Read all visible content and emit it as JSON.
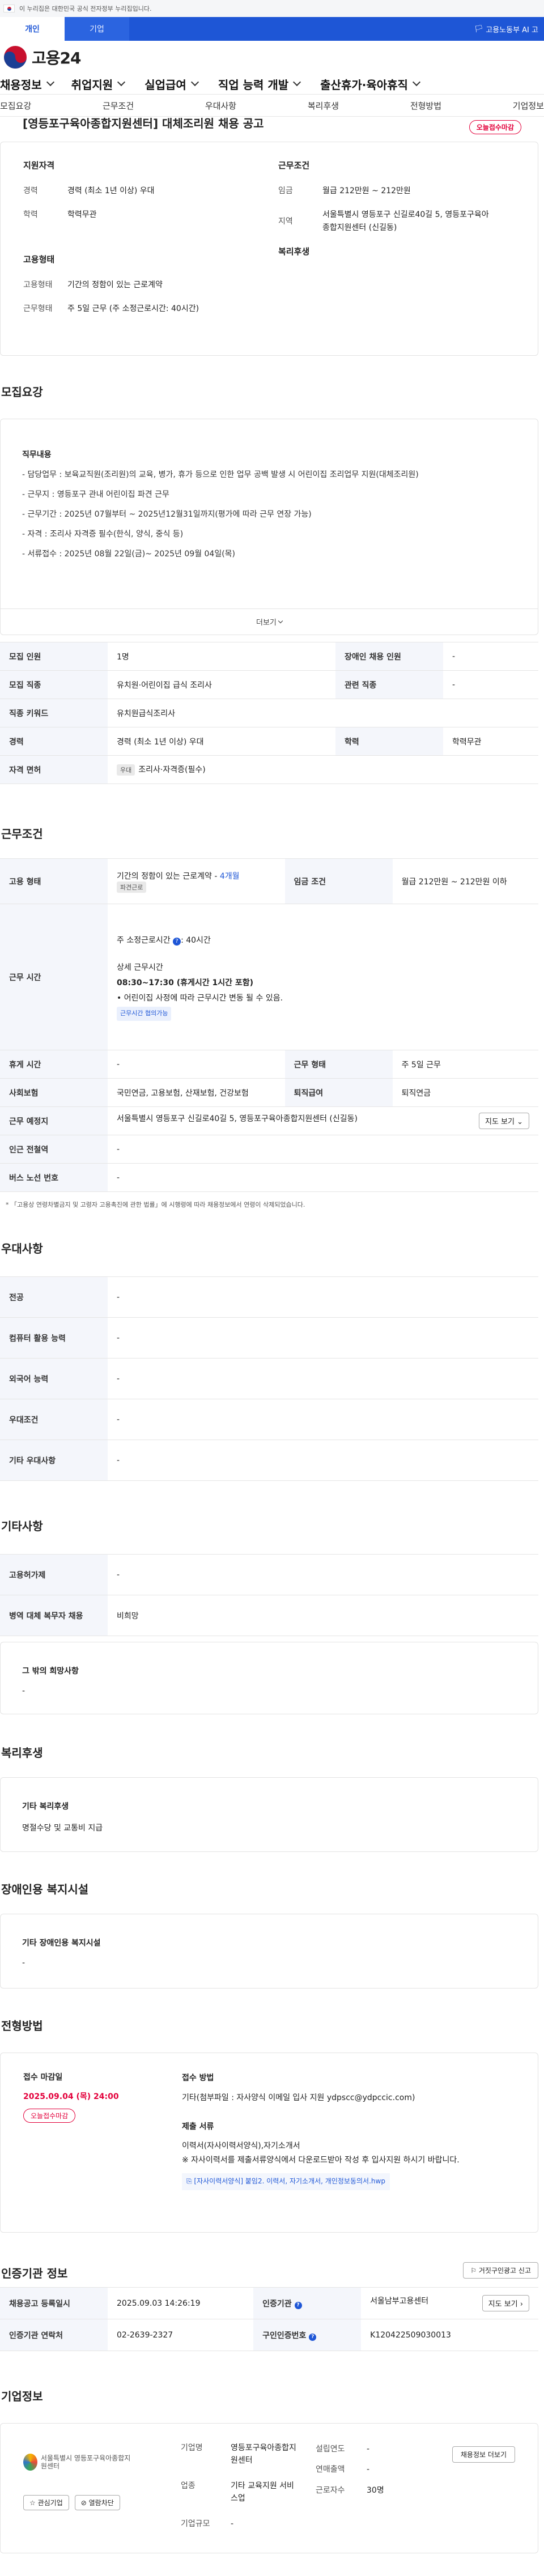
{
  "gov_notice": "이 누리집은 대한민국 공식 전자정부 누리집입니다.",
  "site_tabs": [
    "개인",
    "기업"
  ],
  "ministry": "고용노동부 AI 고",
  "logo": "고용24",
  "gnb": [
    "채용정보",
    "취업지원",
    "실업급여",
    "직업 능력 개발",
    "출산휴가·육아휴직"
  ],
  "subnav": [
    "모집요강",
    "근무조건",
    "우대사항",
    "복리후생",
    "전형방법",
    "기업정보"
  ],
  "posting": {
    "title": "[영등포구육아종합지원센터] 대체조리원 채용 공고",
    "badge": "오늘접수마감"
  },
  "summary": {
    "qual": {
      "title": "지원자격",
      "career_k": "경력",
      "career_v": "경력 (최소 1년 이상) 우대",
      "edu_k": "학력",
      "edu_v": "학력무관"
    },
    "cond": {
      "title": "근무조건",
      "pay_k": "임금",
      "pay_v": "월급 212만원 ~ 212만원",
      "area_k": "지역",
      "area_v": "서울특별시 영등포구 신길로40길 5, 영등포구육아종합지원센터 (신길동)"
    },
    "form": {
      "title": "고용형태",
      "type_k": "고용형태",
      "type_v": "기간의 정함이 있는 근로계약",
      "hours_k": "근무형태",
      "hours_v": "주 5일 근무 (주 소정근로시간: 40시간)"
    },
    "welfare": {
      "title": "복리후생"
    }
  },
  "recruit": {
    "title": "모집요강",
    "job_head": "직무내용",
    "job_lines": [
      "- 담당업무 : 보육교직원(조리원)의 교육, 병가, 휴가 등으로 인한 업무 공백 발생 시 어린이집 조리업무 지원(대체조리원)",
      "- 근무지 : 영등포구 관내 어린이집 파견 근무",
      "- 근무기간 : 2025년 07월부터 ~ 2025년12월31일까지(평가에 따라 근무 연장 가능)",
      "- 자격 : 조리사 자격증 필수(한식, 양식, 중식 등)",
      "- 서류접수 : 2025년 08월 22일(금)~ 2025년 09월 04일(목)"
    ],
    "more": "더보기",
    "rows": {
      "count_k": "모집 인원",
      "count_v": "1명",
      "dis_k": "장애인 채용 인원",
      "dis_v": "-",
      "job_k": "모집 직종",
      "job_v": "유치원·어린이집 급식 조리사",
      "rel_k": "관련 직종",
      "rel_v": "-",
      "kw_k": "직종 키워드",
      "kw_v": "유치원급식조리사",
      "career_k": "경력",
      "career_v": "경력 (최소 1년 이상) 우대",
      "edu_k": "학력",
      "edu_v": "학력무관",
      "lic_k": "자격 면허",
      "lic_tag": "우대",
      "lic_v": "조리사·자격증(필수)"
    }
  },
  "work": {
    "title": "근무조건",
    "type_k": "고용 형태",
    "type_v": "기간의 정함이 있는 근로계약 -",
    "type_months": "4개월",
    "type_tag": "파견근로",
    "pay_k": "임금 조건",
    "pay_v": "월급 212만원 ~ 212만원 이하",
    "time_k": "근무 시간",
    "time_1": "주 소정근로시간",
    "time_1b": ": 40시간",
    "time_2h": "상세 근무시간",
    "time_2": "08:30~17:30 (휴게시간 1시간 포함)",
    "time_3": "• 어린이집 사정에 따라 근무시간 변동 될 수 있음.",
    "time_tag": "근무시간 협의가능",
    "rest_k": "휴게 시간",
    "rest_v": "-",
    "shape_k": "근무 형태",
    "shape_v": "주 5일 근무",
    "ins_k": "사회보험",
    "ins_v": "국민연금, 고용보험, 산재보험, 건강보험",
    "ret_k": "퇴직급여",
    "ret_v": "퇴직연금",
    "loc_k": "근무 예정지",
    "loc_v": "서울특별시 영등포구 신길로40길 5, 영등포구육아종합지원센터 (신길동)",
    "map": "지도 보기",
    "sta_k": "인근 전철역",
    "sta_v": "-",
    "bus_k": "버스 노선 번호",
    "bus_v": "-",
    "note": "* 「고용상 연령차별금지 및 고령자 고용촉진에 관한 법률」에 시행령에 따라 채용정보에서 연령이 삭제되었습니다."
  },
  "pref": {
    "title": "우대사항",
    "rows": [
      [
        "전공",
        "-"
      ],
      [
        "컴퓨터 활용 능력",
        "-"
      ],
      [
        "외국어 능력",
        "-"
      ],
      [
        "우대조건",
        "-"
      ],
      [
        "기타 우대사항",
        "-"
      ]
    ]
  },
  "etc": {
    "title": "기타사항",
    "rows": [
      [
        "고용허가제",
        "-"
      ],
      [
        "병역 대체 복무자 채용",
        "비희망"
      ]
    ],
    "box_head": "그 밖의 희망사항",
    "box_v": "-"
  },
  "benefit": {
    "title": "복리후생",
    "head": "기타 복리후생",
    "v": "명절수당 및 교통비 지급"
  },
  "disab": {
    "title": "장애인용 복지시설",
    "head": "기타 장애인용 복지시설",
    "v": "-"
  },
  "process": {
    "title": "전형방법",
    "deadline_k": "접수 마감일",
    "deadline_v": "2025.09.04 (목) 24:00",
    "deadline_badge": "오늘접수마감",
    "method_k": "접수 방법",
    "method_v": "기타(첨부파일 : 자사양식 이메일 입사 지원  ydpscc@ydpccic.com)",
    "docs_k": "제출 서류",
    "docs_1": "이력서(자사이력서양식),자기소개서",
    "docs_2": "※ 자사이력서를 제출서류양식에서 다운로드받아 작성 후 입사지원 하시기 바랍니다.",
    "docs_file": "[자사이력서양식] 붙임2. 이력서, 자기소개서, 개인정보동의서.hwp"
  },
  "auth": {
    "title": "인증기관 정보",
    "btn": "거짓구인광고 신고",
    "reg_k": "채용공고 등록일시",
    "reg_v": "2025.09.03 14:26:19",
    "org_k": "인증기관",
    "org_v": "서울남부고용센터",
    "map": "지도 보기",
    "tel_k": "인증기관 연락처",
    "tel_v": "02-2639-2327",
    "id_k": "구인인증번호",
    "id_v": "K120422509030013"
  },
  "company": {
    "title": "기업정보",
    "logo_text": "서울특별시 영등포구육아종합지원센터",
    "name_k": "기업명",
    "name_v": "영등포구육아종합지원센터",
    "year_k": "설립연도",
    "year_v": "-",
    "ind_k": "업종",
    "ind_v": "기타 교육지원 서비스업",
    "rev_k": "연매출액",
    "rev_v": "-",
    "emp_k": "근로자수",
    "emp_v": "30명",
    "size_k": "기업규모",
    "size_v": "-",
    "btn_more": "채용정보 더보기",
    "btn_fav": "관심기업",
    "btn_block": "열람차단"
  }
}
